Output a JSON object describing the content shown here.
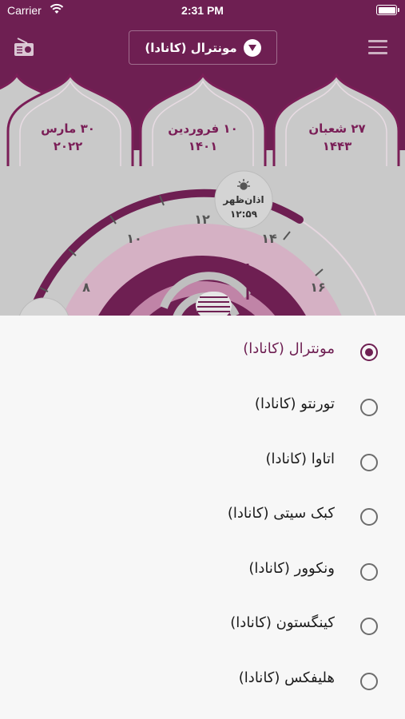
{
  "status_bar": {
    "carrier": "Carrier",
    "time": "2:31 PM"
  },
  "header": {
    "city_selector_label": "مونترال (کانادا)",
    "radio_icon": "radio-icon",
    "menu_icon": "hamburger-menu-icon",
    "caret_icon": "chevron-down-circle-icon"
  },
  "dates": [
    {
      "line1": "۲۷ شعبان",
      "line2": "۱۴۴۳"
    },
    {
      "line1": "۱۰ فروردین",
      "line2": "۱۴۰۱"
    },
    {
      "line1": "۳۰ مارس",
      "line2": "۲۰۲۲"
    }
  ],
  "dial": {
    "prayer_label": "اذان‌ظهر",
    "prayer_time": "۱۲:۵۹",
    "hours": [
      "۸",
      "۱۰",
      "۱۲",
      "۱۴",
      "۱۶"
    ]
  },
  "city_options": [
    {
      "label": "مونترال (کانادا)",
      "selected": true
    },
    {
      "label": "تورنتو (کانادا)",
      "selected": false
    },
    {
      "label": "اتاوا (کانادا)",
      "selected": false
    },
    {
      "label": "کبک سیتی (کانادا)",
      "selected": false
    },
    {
      "label": "ونکوور (کانادا)",
      "selected": false
    },
    {
      "label": "کینگستون (کانادا)",
      "selected": false
    },
    {
      "label": "هلیفکس (کانادا)",
      "selected": false
    }
  ],
  "colors": {
    "primary": "#6e1f52",
    "sheet_bg": "#f7f7f7"
  }
}
